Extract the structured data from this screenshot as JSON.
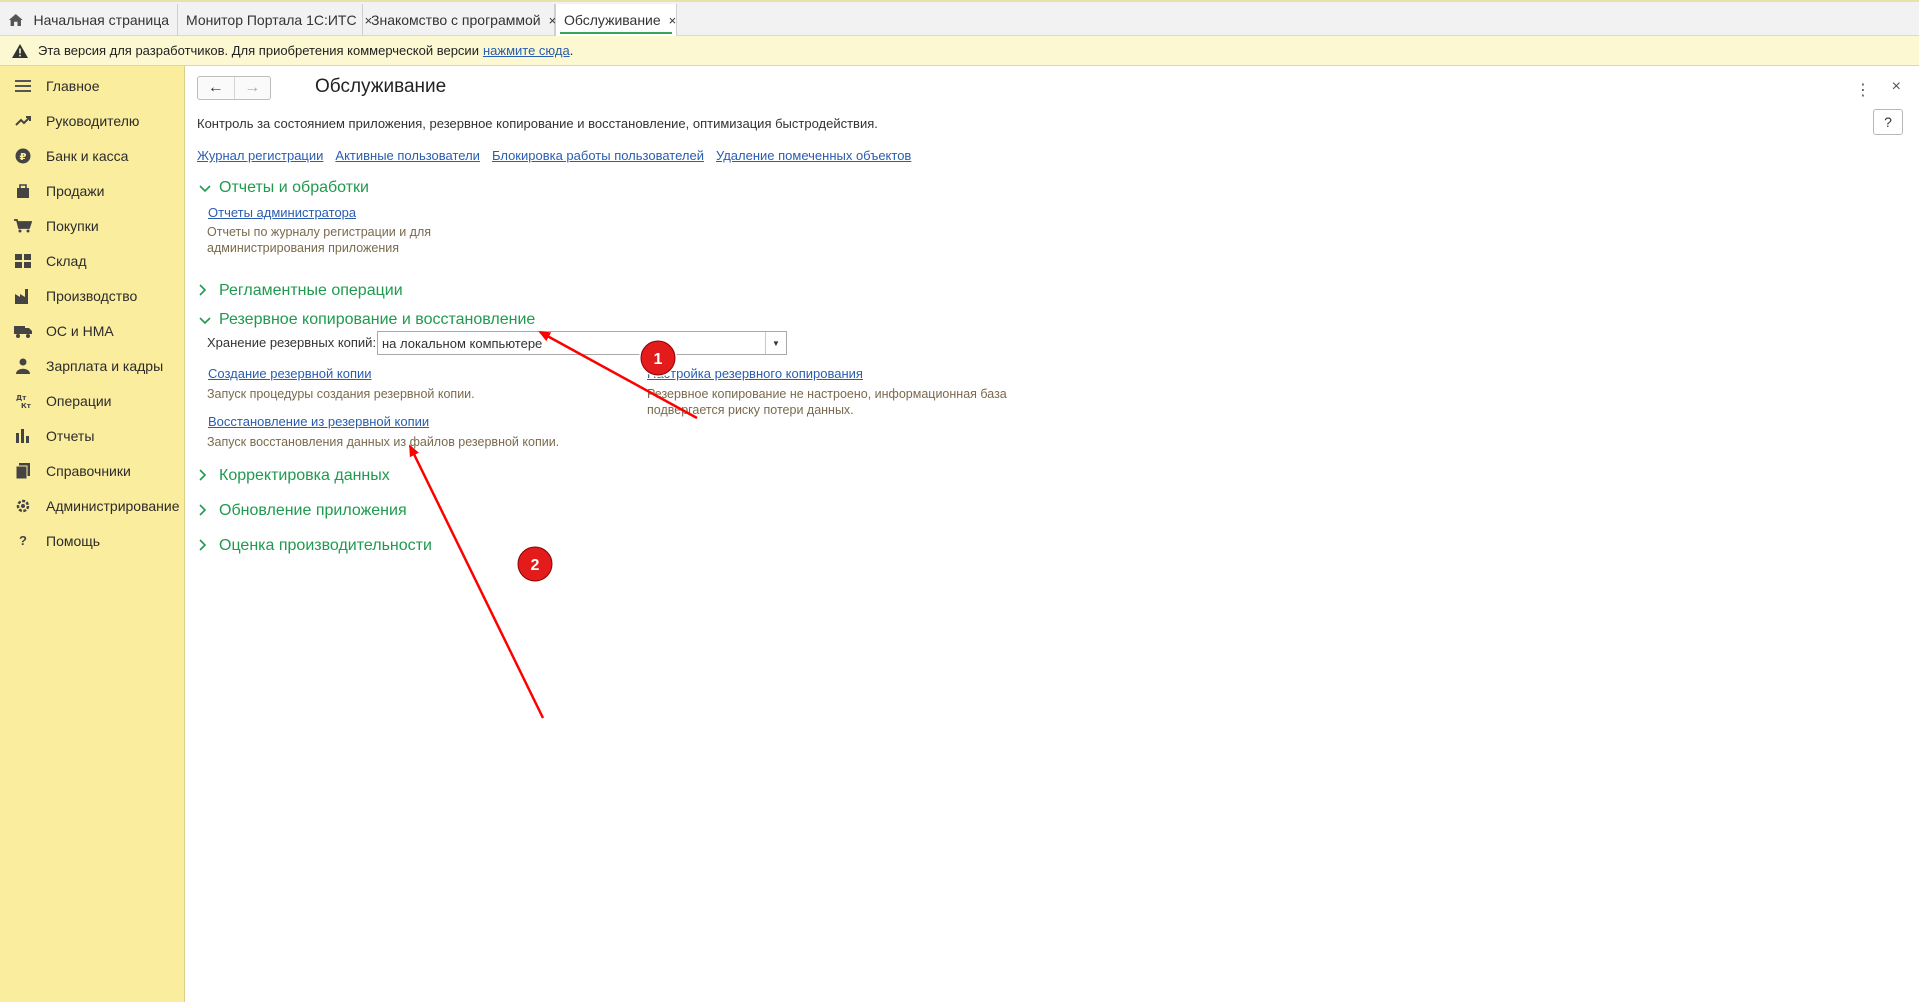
{
  "tabs": [
    {
      "label": "Начальная страница"
    },
    {
      "label": "Монитор Портала 1С:ИТС"
    },
    {
      "label": "Знакомство с программой"
    },
    {
      "label": "Обслуживание"
    }
  ],
  "tab_close_glyph": "×",
  "warning": {
    "text": "Эта версия для разработчиков. Для приобретения коммерческой версии",
    "link": "нажмите сюда",
    "tail": "."
  },
  "sidebar": {
    "items": [
      {
        "label": "Главное",
        "icon": "menu-icon"
      },
      {
        "label": "Руководителю",
        "icon": "trend-icon"
      },
      {
        "label": "Банк и касса",
        "icon": "ruble-icon"
      },
      {
        "label": "Продажи",
        "icon": "bag-icon"
      },
      {
        "label": "Покупки",
        "icon": "cart-icon"
      },
      {
        "label": "Склад",
        "icon": "grid-icon"
      },
      {
        "label": "Производство",
        "icon": "factory-icon"
      },
      {
        "label": "ОС и НМА",
        "icon": "truck-icon"
      },
      {
        "label": "Зарплата и кадры",
        "icon": "person-icon"
      },
      {
        "label": "Операции",
        "icon": "dt-kt-icon"
      },
      {
        "label": "Отчеты",
        "icon": "bar-chart-icon"
      },
      {
        "label": "Справочники",
        "icon": "book-icon"
      },
      {
        "label": "Администрирование",
        "icon": "gear-icon"
      },
      {
        "label": "Помощь",
        "icon": "question-icon"
      }
    ]
  },
  "main": {
    "title": "Обслуживание",
    "description": "Контроль за состоянием приложения, резервное копирование и восстановление, оптимизация быстродействия.",
    "help_label": "?",
    "links": [
      "Журнал регистрации",
      "Активные пользователи",
      "Блокировка работы пользователей",
      "Удаление помеченных объектов"
    ],
    "sections": {
      "reports": {
        "title": "Отчеты и обработки",
        "admin_reports_link": "Отчеты администратора",
        "admin_reports_hint": "Отчеты по журналу регистрации и для администрирования приложения"
      },
      "routine": {
        "title": "Регламентные операции"
      },
      "backup": {
        "title": "Резервное копирование и восстановление",
        "storage_label": "Хранение резервных копий:",
        "storage_value": "на локальном компьютере",
        "create_link": "Создание резервной копии",
        "create_hint": "Запуск процедуры создания резервной копии.",
        "restore_link": "Восстановление из резервной копии",
        "restore_hint": "Запуск восстановления данных из файлов резервной копии.",
        "settings_link": "Настройка резервного копирования",
        "settings_hint": "Резервное копирование не настроено, информационная база подвергается риску потери данных."
      },
      "correction": {
        "title": "Корректировка данных"
      },
      "update": {
        "title": "Обновление приложения"
      },
      "performance": {
        "title": "Оценка производительности"
      }
    }
  },
  "annotations": {
    "marker_1": "1",
    "marker_2": "2",
    "arrow_color": "#ff0000",
    "marker_color": "#e31b1b"
  },
  "colors": {
    "sidebar_bg": "#fbed9e",
    "section_title": "#1f9a4e",
    "link": "#2a5db0",
    "warning_bg": "#fcf8d2"
  }
}
